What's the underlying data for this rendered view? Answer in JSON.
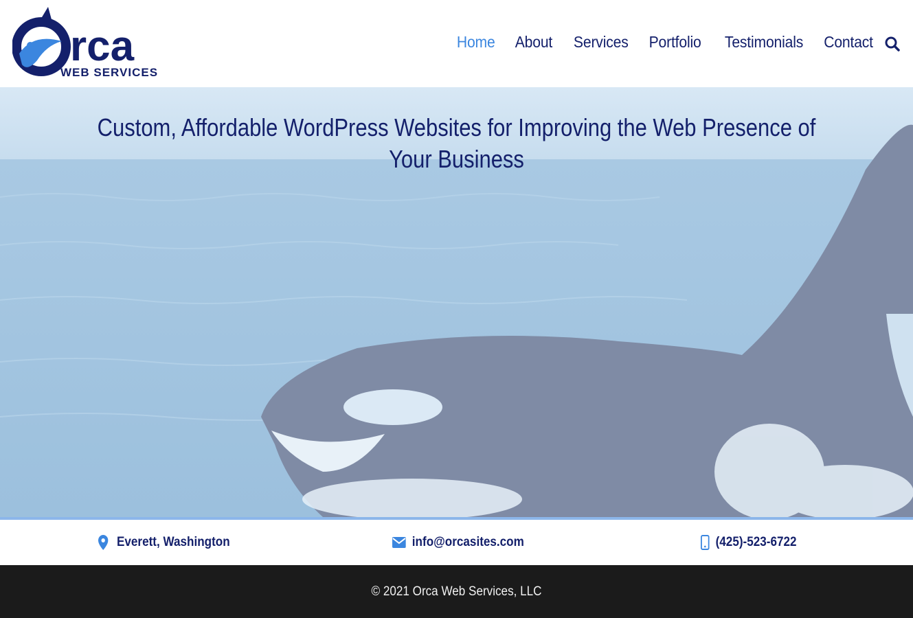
{
  "brand": {
    "logo_word": "rca",
    "logo_letter": "O",
    "logo_sub": "WEB SERVICES",
    "colors": {
      "navy": "#14206b",
      "accent_blue": "#3b86df",
      "light_blue": "#8cb6ea",
      "footer_bg": "#1b1b1b"
    }
  },
  "nav": {
    "items": [
      {
        "label": "Home",
        "active": true
      },
      {
        "label": "About",
        "active": false
      },
      {
        "label": "Services",
        "active": false
      },
      {
        "label": "Portfolio",
        "active": false
      },
      {
        "label": "Testimonials",
        "active": false
      },
      {
        "label": "Contact",
        "active": false
      }
    ],
    "search_icon": "search-icon"
  },
  "hero": {
    "title": "Custom, Affordable WordPress Websites for Improving the Web Presence of Your Business"
  },
  "contact": {
    "location": {
      "icon": "map-pin-icon",
      "text": "Everett, Washington"
    },
    "email": {
      "icon": "envelope-icon",
      "text": "info@orcasites.com"
    },
    "phone": {
      "icon": "mobile-phone-icon",
      "text": "(425)-523-6722"
    }
  },
  "footer": {
    "copyright": "© 2021 Orca Web Services, LLC"
  }
}
